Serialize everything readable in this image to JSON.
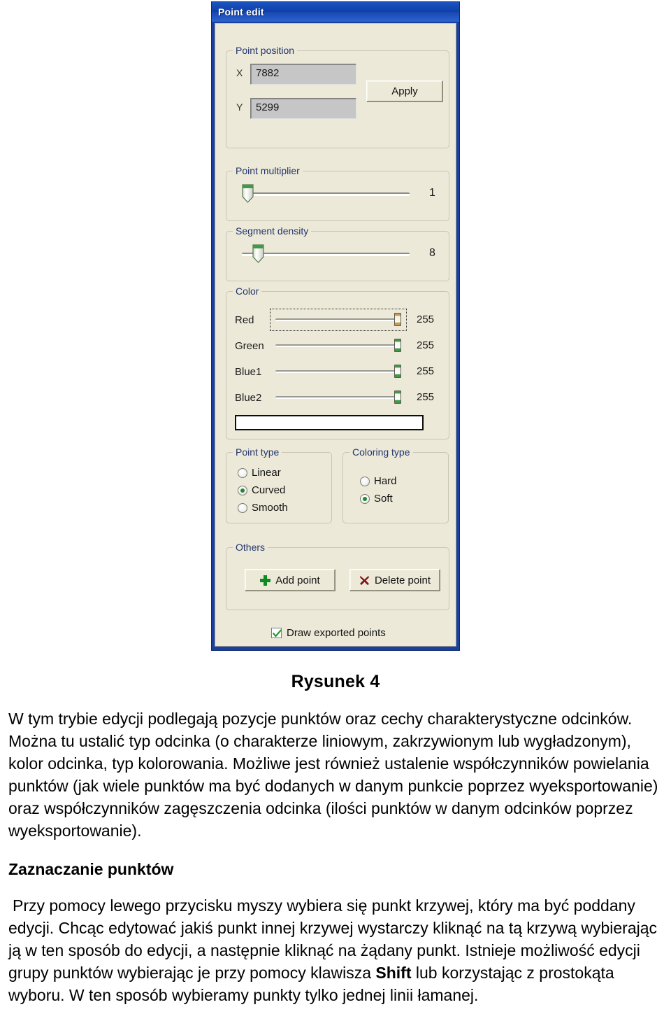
{
  "dialog": {
    "title": "Point edit",
    "point_position": {
      "legend": "Point position",
      "x_label": "X",
      "x_value": "7882",
      "y_label": "Y",
      "y_value": "5299",
      "apply_label": "Apply"
    },
    "point_multiplier": {
      "legend": "Point multiplier",
      "value": "1",
      "percent": 2
    },
    "segment_density": {
      "legend": "Segment density",
      "value": "8",
      "percent": 8
    },
    "color": {
      "legend": "Color",
      "channels": [
        {
          "label": "Red",
          "value": "255",
          "percent": 100,
          "thumb": "tan",
          "focused": true
        },
        {
          "label": "Green",
          "value": "255",
          "percent": 100,
          "thumb": "green",
          "focused": false
        },
        {
          "label": "Blue1",
          "value": "255",
          "percent": 100,
          "thumb": "green",
          "focused": false
        },
        {
          "label": "Blue2",
          "value": "255",
          "percent": 100,
          "thumb": "green",
          "focused": false
        }
      ],
      "swatch_hex": "#ffffff"
    },
    "point_type": {
      "legend": "Point type",
      "options": [
        {
          "label": "Linear",
          "checked": false
        },
        {
          "label": "Curved",
          "checked": true
        },
        {
          "label": "Smooth",
          "checked": false
        }
      ]
    },
    "coloring_type": {
      "legend": "Coloring type",
      "options": [
        {
          "label": "Hard",
          "checked": false
        },
        {
          "label": "Soft",
          "checked": true
        }
      ]
    },
    "others": {
      "legend": "Others",
      "add_point_label": "Add point",
      "delete_point_label": "Delete point",
      "add_icon_color": "#0f8a22",
      "delete_icon_color": "#7d1414"
    },
    "draw_exported": {
      "label": "Draw exported points",
      "checked": true,
      "check_color": "#2f9b33"
    }
  },
  "document": {
    "figure_caption": "Rysunek 4",
    "paragraph_1": "W tym trybie edycji podlegają pozycje punktów oraz cechy charakterystyczne odcinków. Można tu ustalić typ odcinka (o charakterze liniowym, zakrzywionym lub wygładzonym), kolor odcinka, typ kolorowania. Możliwe jest również ustalenie współczynników powielania punktów (jak wiele punktów ma być dodanych w danym punkcie poprzez wyeksportowanie) oraz współczynników zagęszczenia odcinka (ilości punktów w danym odcinków poprzez wyeksportowanie).",
    "section_heading": "Zaznaczanie punktów",
    "paragraph_2_part1": "Przy pomocy lewego przycisku myszy wybiera się punkt krzywej, który ma być poddany edycji. Chcąc edytować jakiś punkt innej krzywej wystarczy kliknąć na tą krzywą wybierając ją w ten sposób do edycji, a następnie kliknąć na żądany punkt. Istnieje możliwość edycji grupy punktów wybierając je przy pomocy klawisza ",
    "paragraph_2_bold": "Shift",
    "paragraph_2_part2": " lub korzystając z prostokąta wyboru. W ten sposób wybieramy punkty tylko jednej linii łamanej."
  }
}
